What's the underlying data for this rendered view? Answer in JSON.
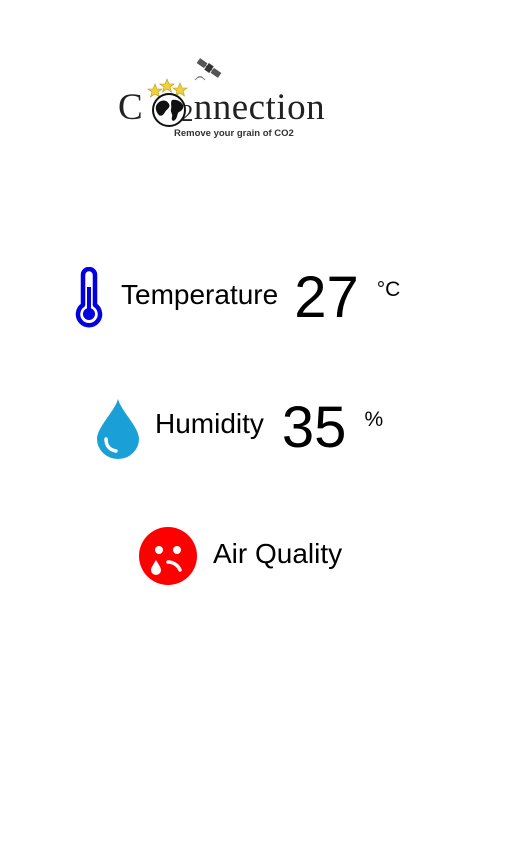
{
  "logo": {
    "word_first": "C",
    "word_subscript": "2",
    "word_rest": "nnection",
    "tagline": "Remove your grain of CO2",
    "icons": [
      "globe-icon",
      "satellite-icon"
    ]
  },
  "metrics": {
    "temperature": {
      "label": "Temperature",
      "value": "27",
      "unit": "°C",
      "icon": "thermometer-icon",
      "color": "#0000e0"
    },
    "humidity": {
      "label": "Humidity",
      "value": "35",
      "unit": "%",
      "icon": "water-drop-icon",
      "color": "#1a9fd6"
    },
    "air_quality": {
      "label": "Air Quality",
      "icon": "sad-face-icon",
      "color": "#ff0000"
    }
  }
}
